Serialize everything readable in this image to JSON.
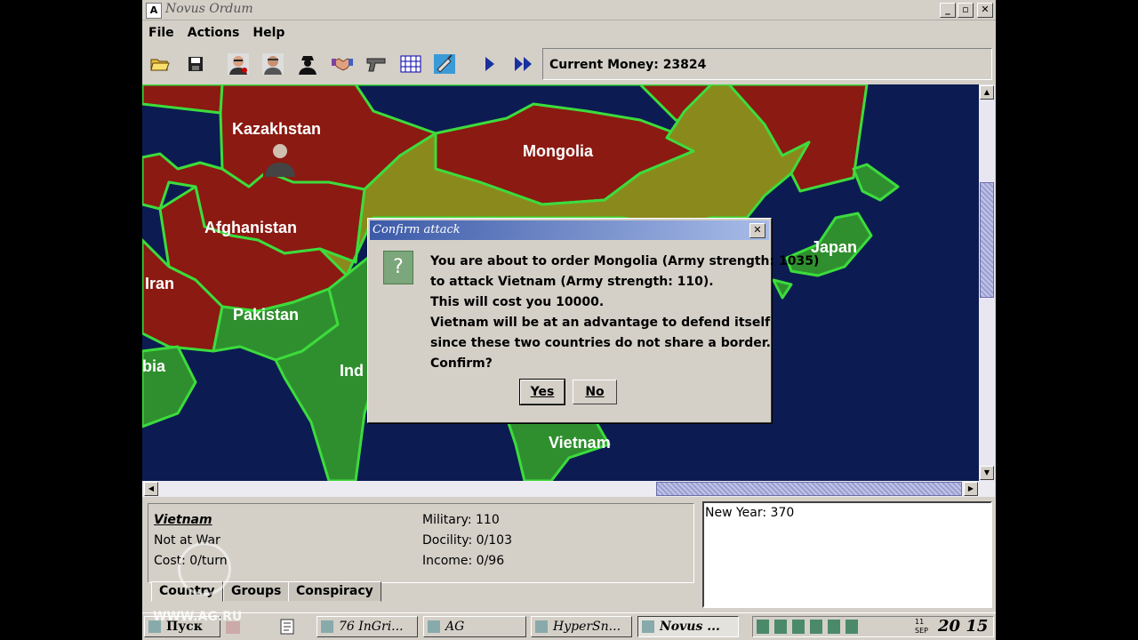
{
  "window": {
    "title": "Novus Ordum"
  },
  "menu": [
    {
      "label": "File"
    },
    {
      "label": "Actions"
    },
    {
      "label": "Help"
    }
  ],
  "toolbar": {
    "icons": [
      "open-folder-icon",
      "save-disk-icon",
      "agent-portrait-icon",
      "spy-portrait-icon",
      "silhouette-icon",
      "handshake-icon",
      "pistol-icon",
      "grid-icon",
      "syringe-icon",
      "play-icon",
      "fast-forward-icon"
    ],
    "money_label": "Current Money: 23824"
  },
  "map": {
    "countries": [
      {
        "name": "Kazakhstan"
      },
      {
        "name": "Mongolia"
      },
      {
        "name": "Afghanistan"
      },
      {
        "name": "Japan"
      },
      {
        "name": "Iran"
      },
      {
        "name": "Pakistan"
      },
      {
        "name": "bia"
      },
      {
        "name": "Ind"
      },
      {
        "name": "Vietnam"
      }
    ],
    "colors": {
      "ocean": "#0c1c52",
      "hostile": "#8b1a12",
      "neutral": "#8a8a1c",
      "friendly": "#2f8f2f",
      "border": "#3cdc3c"
    }
  },
  "dialog": {
    "title": "Confirm attack",
    "lines": [
      "You are about to order Mongolia (Army strength: 1035)",
      "to attack Vietnam (Army strength: 110).",
      "This will cost you 10000.",
      "Vietnam will be at an advantage to defend itself",
      "since these two countries do not share a border.",
      "Confirm?"
    ],
    "yes": "Yes",
    "no": "No"
  },
  "info": {
    "country": "Vietnam",
    "war_status": "Not at War",
    "cost": "Cost: 0/turn",
    "military": "Military: 110",
    "docility": "Docility: 0/103",
    "income": "Income: 0/96"
  },
  "tabs": [
    {
      "label": "Country"
    },
    {
      "label": "Groups"
    },
    {
      "label": "Conspiracy"
    }
  ],
  "log": {
    "text": "New Year: 370"
  },
  "taskbar": {
    "tasks": [
      {
        "label": "Пуск"
      },
      {
        "label": "76 InGri..."
      },
      {
        "label": "AG"
      },
      {
        "label": "HyperSn..."
      },
      {
        "label": "Novus ..."
      }
    ],
    "clock": {
      "date": "11 SEP",
      "time": "20 15"
    }
  },
  "watermark": "WWW.AG.RU"
}
